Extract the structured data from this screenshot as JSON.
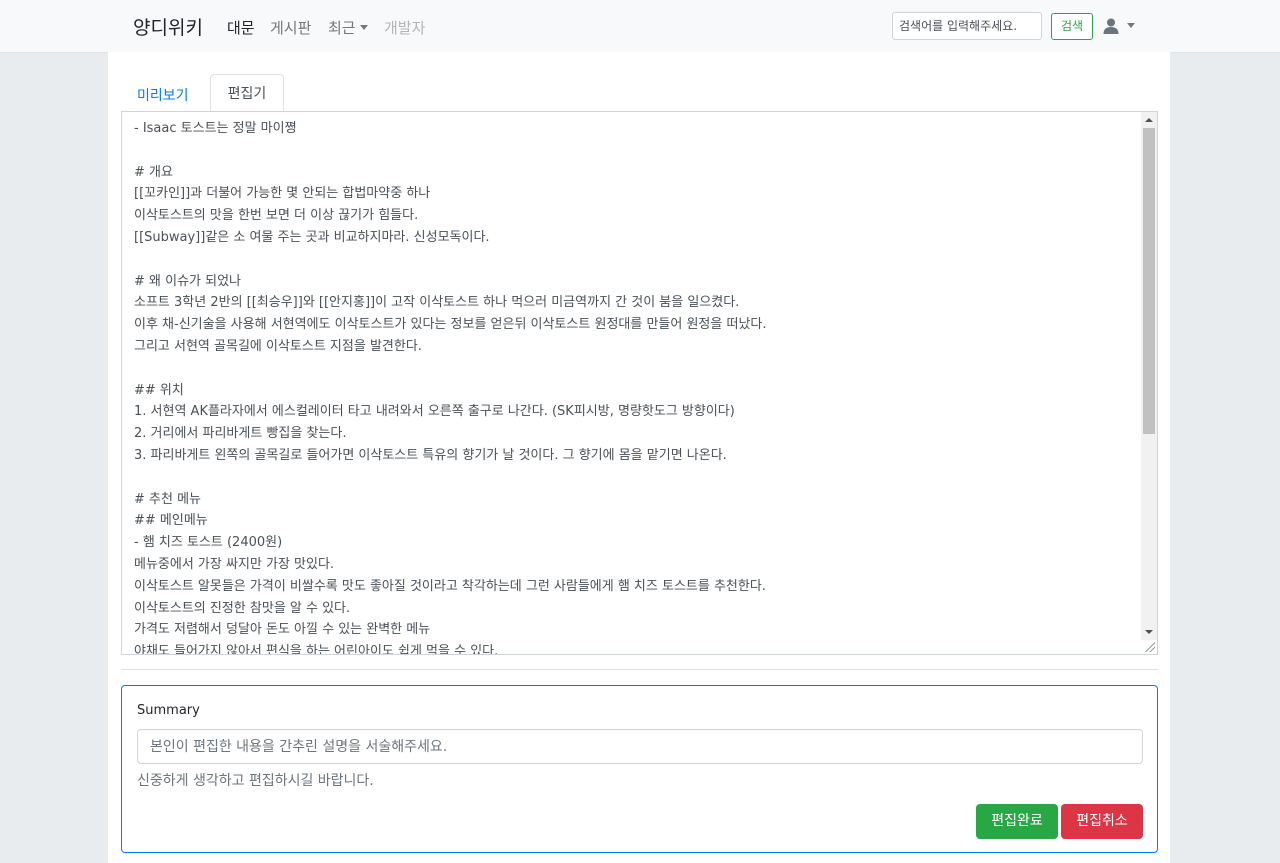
{
  "navbar": {
    "brand": "양디위키",
    "links": [
      "대문",
      "게시판",
      "최근",
      "개발자"
    ],
    "search_placeholder": "검색어를 입력해주세요.",
    "search_button": "검색",
    "user_icon": "user-icon"
  },
  "tabs": {
    "preview": "미리보기",
    "editor": "편집기"
  },
  "editor": {
    "content": "- Isaac 토스트는 정말 마이쪙\n\n# 개요\n[[꼬카인]]과 더불어 가능한 몇 안되는 합법마약중 하나\n이삭토스트의 맛을 한번 보면 더 이상 끊기가 힘들다.\n[[Subway]]같은 소 여물 주는 곳과 비교하지마라. 신성모독이다.\n\n# 왜 이슈가 되었나\n소프트 3학년 2반의 [[최승우]]와 [[안지홍]]이 고작 이삭토스트 하나 먹으러 미금역까지 간 것이 붐을 일으켰다.\n이후 채-신기술을 사용해 서현역에도 이삭토스트가 있다는 정보를 얻은뒤 이삭토스트 원정대를 만들어 원정을 떠났다.\n그리고 서현역 골목길에 이삭토스트 지점을 발견한다.\n\n## 위치\n1. 서현역 AK플라자에서 에스컬레이터 타고 내려와서 오른쪽 출구로 나간다. (SK피시방, 명량핫도그 방향이다)\n2. 거리에서 파리바게트 빵집을 찾는다.\n3. 파리바게트 왼쪽의 골목길로 들어가면 이삭토스트 특유의 향기가 날 것이다. 그 향기에 몸을 맡기면 나온다.\n\n# 추천 메뉴\n## 메인메뉴\n- 햄 치즈 토스트 (2400원)\n메뉴중에서 가장 싸지만 가장 맛있다.\n이삭토스트 알못들은 가격이 비쌀수록 맛도 좋아질 것이라고 착각하는데 그런 사람들에게 햄 치즈 토스트를 추천한다.\n이삭토스트의 진정한 참맛을 알 수 있다.\n가격도 저렴해서 덩달아 돈도 아낄 수 있는 완벽한 메뉴\n야채도 들어가지 않아서 편식을 하는 어린아이도 쉽게 먹을 수 있다."
  },
  "summary": {
    "label": "Summary",
    "placeholder": "본인이 편집한 내용을 간추린 설명을 서술해주세요.",
    "help": "신중하게 생각하고 편집하시길 바랍니다.",
    "save_button": "편집완료",
    "cancel_button": "편집취소"
  },
  "colors": {
    "primary": "#007bff",
    "success": "#28a745",
    "danger": "#dc3545"
  }
}
